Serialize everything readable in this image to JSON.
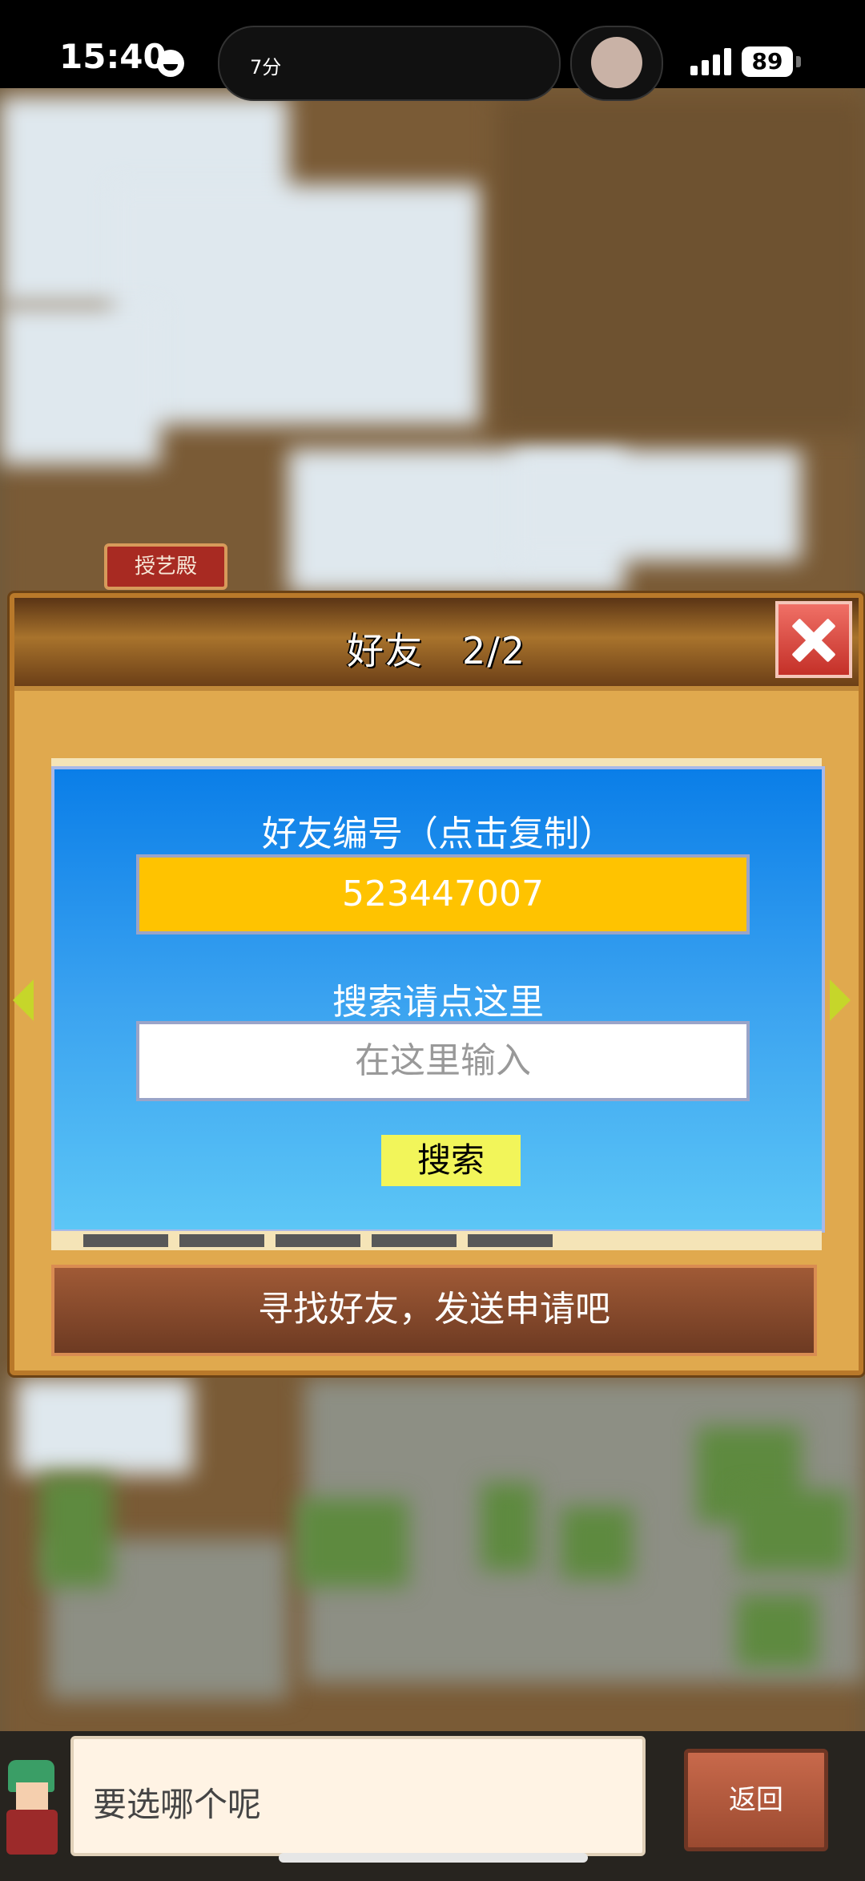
{
  "status_bar": {
    "time": "15:40",
    "activity_text": "7分",
    "battery": "89"
  },
  "map": {
    "building_label": "授艺殿"
  },
  "dialog": {
    "title": "好友　2/2",
    "friend_id_label": "好友编号（点击复制）",
    "friend_id": "523447007",
    "search_label": "搜索请点这里",
    "search_placeholder": "在这里输入",
    "search_button": "搜索",
    "find_friends_button": "寻找好友，发送申请吧"
  },
  "bottom_bar": {
    "prompt": "要选哪个呢",
    "back_button": "返回"
  },
  "colors": {
    "panel_blue": "#1a8af0",
    "id_field": "#ffc300",
    "search_button": "#f2f55a",
    "close_button": "#e04a3f",
    "dialog_frame": "#e0a94e"
  },
  "icons": [
    "smiley-icon",
    "signal-icon",
    "battery-icon",
    "close-icon",
    "arrow-left-icon",
    "arrow-right-icon"
  ]
}
